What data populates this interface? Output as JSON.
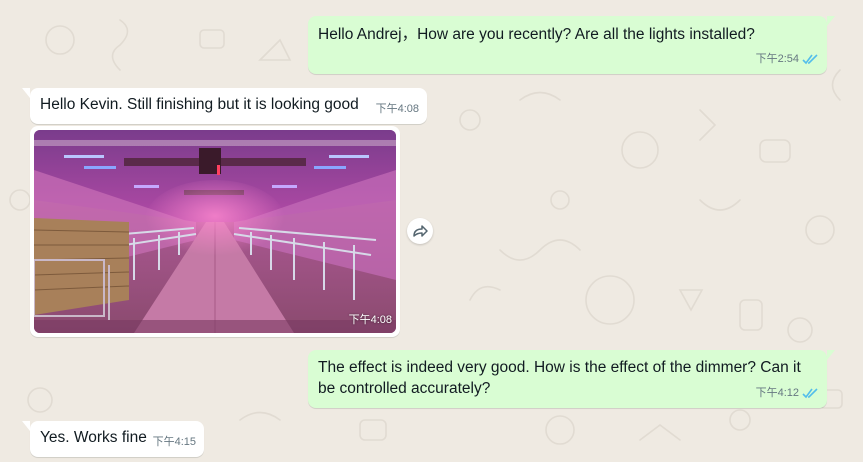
{
  "colors": {
    "background": "#efeae2",
    "outgoing_bubble": "#d9fdd3",
    "incoming_bubble": "#ffffff",
    "timestamp": "#667781",
    "read_ticks": "#53bdeb"
  },
  "messages": [
    {
      "direction": "outgoing",
      "text": "Hello Andrej，How are you recently?  Are all the lights installed?",
      "time": "下午2:54",
      "status": "read"
    },
    {
      "direction": "incoming",
      "text": "Hello Kevin. Still finishing but it is looking good",
      "time": "下午4:08"
    },
    {
      "direction": "incoming",
      "type": "image",
      "image_description": "Barn interior with pink and purple grow lights",
      "time": "下午4:08",
      "action_icon": "forward-icon"
    },
    {
      "direction": "outgoing",
      "text": "The effect is indeed very good. How is the effect of the dimmer? Can it be controlled accurately?",
      "time": "下午4:12",
      "status": "read"
    },
    {
      "direction": "incoming",
      "text": "Yes. Works fine",
      "time": "下午4:15"
    }
  ]
}
